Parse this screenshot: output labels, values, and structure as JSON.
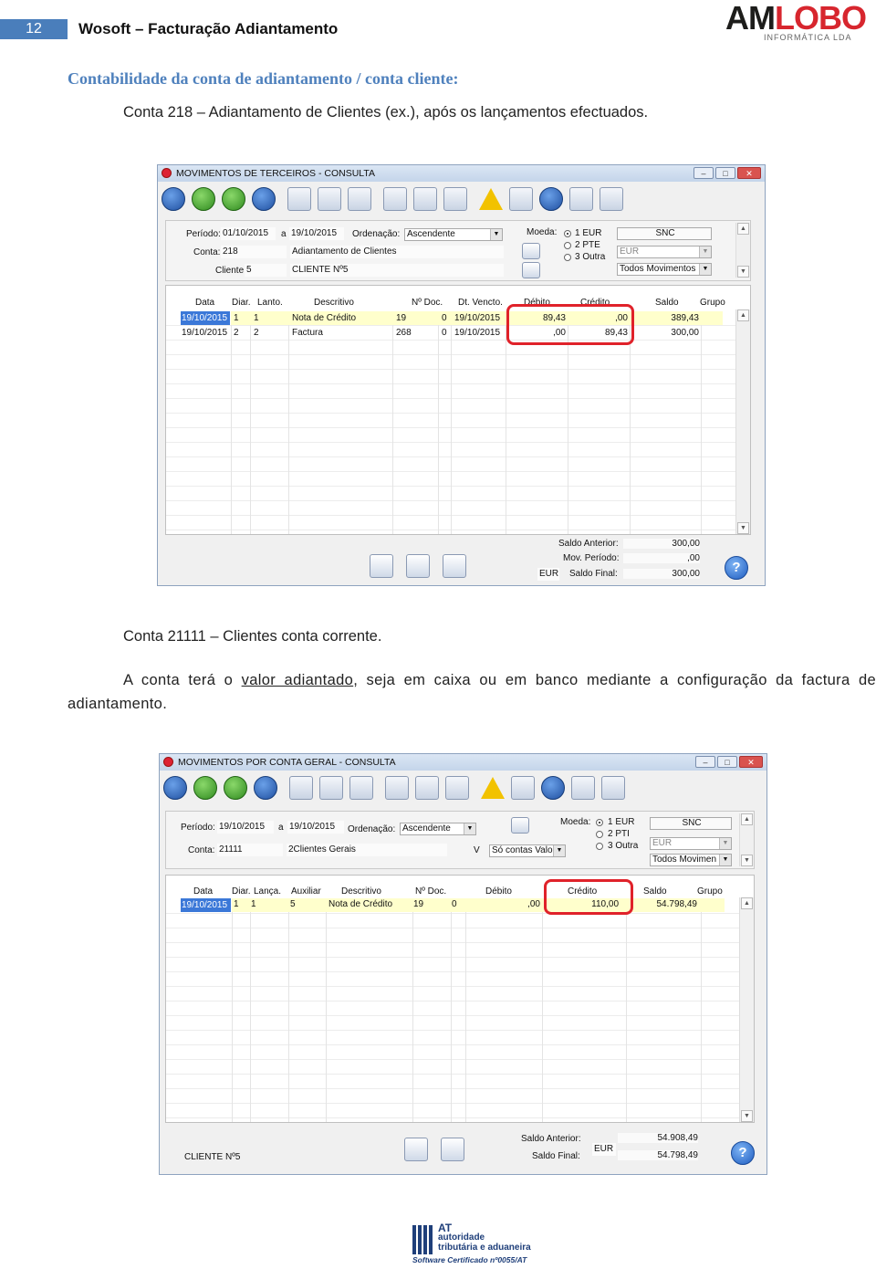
{
  "header": {
    "page_number": "12",
    "doc_title": "Wosoft – Facturação Adiantamento",
    "logo": {
      "main_am": "AM",
      "main_lobo": "LOBO",
      "sub": "INFORMÁTICA LDA"
    }
  },
  "section_heading": "Contabilidade da conta de adiantamento / conta cliente:",
  "para1": "Conta 218 – Adiantamento de Clientes (ex.), após os lançamentos efectuados.",
  "para2": "Conta 21111 – Clientes conta corrente.",
  "para3_a": "A conta terá o ",
  "para3_link": "valor adiantado",
  "para3_b": ", seja em caixa ou em banco mediante a configuração da factura de adiantamento.",
  "window1": {
    "title": "MOVIMENTOS DE TERCEIROS - CONSULTA",
    "periodo_label": "Período:",
    "periodo_from": "01/10/2015",
    "a_label": "a",
    "periodo_to": "19/10/2015",
    "ordenacao_label": "Ordenação:",
    "ordenacao_value": "Ascendente",
    "conta_label": "Conta:",
    "conta_value": "218",
    "conta_desc": "Adiantamento de Clientes",
    "cliente_label": "Cliente",
    "cliente_value": "5",
    "cliente_desc": "CLIENTE Nº5",
    "moeda_label": "Moeda:",
    "moedas": [
      "1 EUR",
      "2 PTE",
      "3 Outra"
    ],
    "snc": "SNC",
    "eur_combo": "EUR",
    "movimentos_combo": "Todos Movimentos",
    "columns": [
      "Data",
      "Diar.",
      "Lanto.",
      "Descritivo",
      "Nº Doc.",
      "Dt. Vencto.",
      "Débito",
      "Crédito",
      "Saldo",
      "Grupo"
    ],
    "rows": [
      [
        "19/10/2015",
        "1",
        "1",
        "Nota de Crédito",
        "19",
        "0",
        "19/10/2015",
        "89,43",
        ",00",
        "389,43"
      ],
      [
        "19/10/2015",
        "2",
        "2",
        "Factura",
        "268",
        "0",
        "19/10/2015",
        ",00",
        "89,43",
        "300,00"
      ]
    ],
    "saldo_anterior_label": "Saldo Anterior:",
    "saldo_anterior": "300,00",
    "mov_periodo_label": "Mov. Período:",
    "mov_periodo": ",00",
    "saldo_final_label": "Saldo Final:",
    "saldo_final": "300,00",
    "currency": "EUR"
  },
  "window2": {
    "title": "MOVIMENTOS POR CONTA GERAL - CONSULTA",
    "periodo_label": "Período:",
    "periodo_from": "19/10/2015",
    "a_label": "a",
    "periodo_to": "19/10/2015",
    "ordenacao_label": "Ordenação:",
    "ordenacao_value": "Ascendente",
    "conta_label": "Conta:",
    "conta_value": "21111",
    "conta_desc": "2Clientes Gerais",
    "v_label": "V",
    "so_contas": "Só contas Valo",
    "moeda_label": "Moeda:",
    "moedas": [
      "1 EUR",
      "2 PTI",
      "3 Outra"
    ],
    "snc": "SNC",
    "eur_combo": "EUR",
    "movimentos_combo": "Todos Movimen",
    "columns": [
      "Data",
      "Diar.",
      "Lança.",
      "Auxiliar",
      "Descritivo",
      "Nº Doc.",
      "Débito",
      "Crédito",
      "Saldo",
      "Grupo"
    ],
    "rows": [
      [
        "19/10/2015",
        "1",
        "1",
        "5",
        "Nota de Crédito",
        "19",
        "0",
        ",00",
        "110,00",
        "54.798,49"
      ]
    ],
    "cliente_footer": "CLIENTE Nº5",
    "saldo_anterior_label": "Saldo Anterior:",
    "saldo_anterior": "54.908,49",
    "saldo_final_label": "Saldo Final:",
    "saldo_final": "54.798,49",
    "currency": "EUR"
  },
  "footer_logo": {
    "at": "AT",
    "line1": "autoridade",
    "line2": "tributária e aduaneira",
    "cert": "Software Certificado nº0055/AT"
  }
}
